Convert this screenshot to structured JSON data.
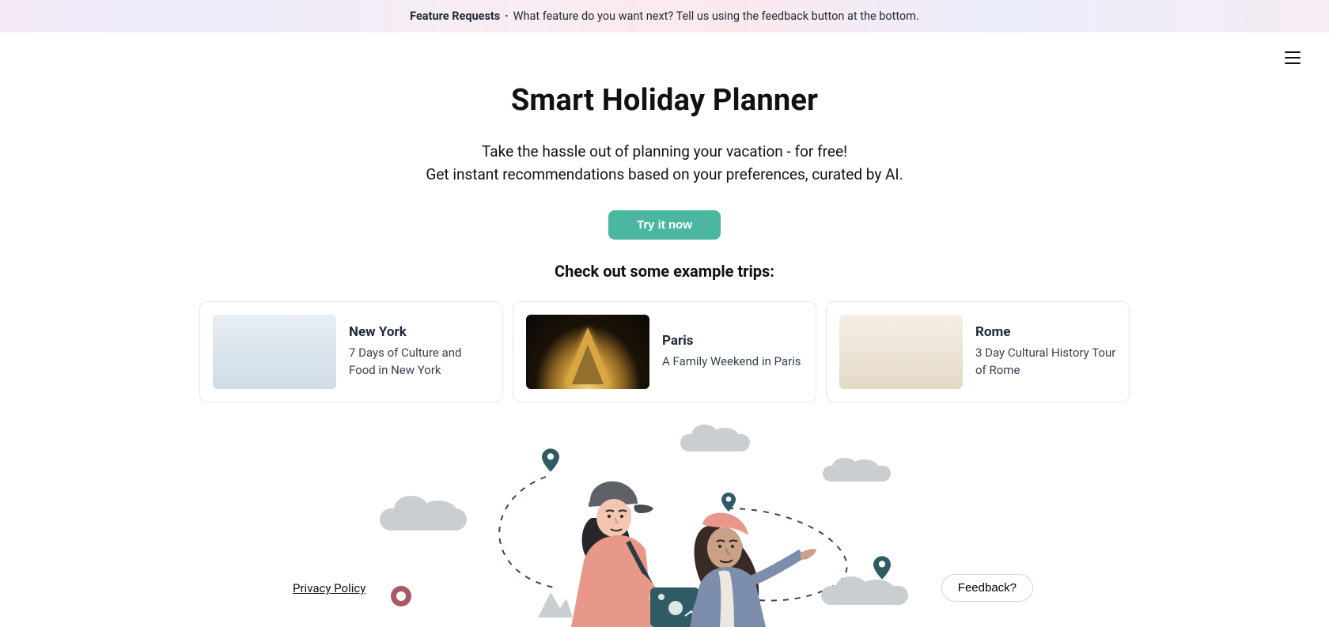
{
  "announcement": {
    "bold": "Feature Requests",
    "text": "What feature do you want next? Tell us using the feedback button at the bottom."
  },
  "hero": {
    "title": "Smart Holiday Planner",
    "subtitle1": "Take the hassle out of planning your vacation - for free!",
    "subtitle2": "Get instant recommendations based on your preferences, curated by AI.",
    "cta": "Try it now",
    "examples_heading": "Check out some example trips:"
  },
  "cards": [
    {
      "title": "New York",
      "desc": "7 Days of Culture and Food in New York"
    },
    {
      "title": "Paris",
      "desc": "A Family Weekend in Paris"
    },
    {
      "title": "Rome",
      "desc": "3 Day Cultural History Tour of Rome"
    }
  ],
  "footer": {
    "privacy": "Privacy Policy",
    "feedback": "Feedback?"
  }
}
